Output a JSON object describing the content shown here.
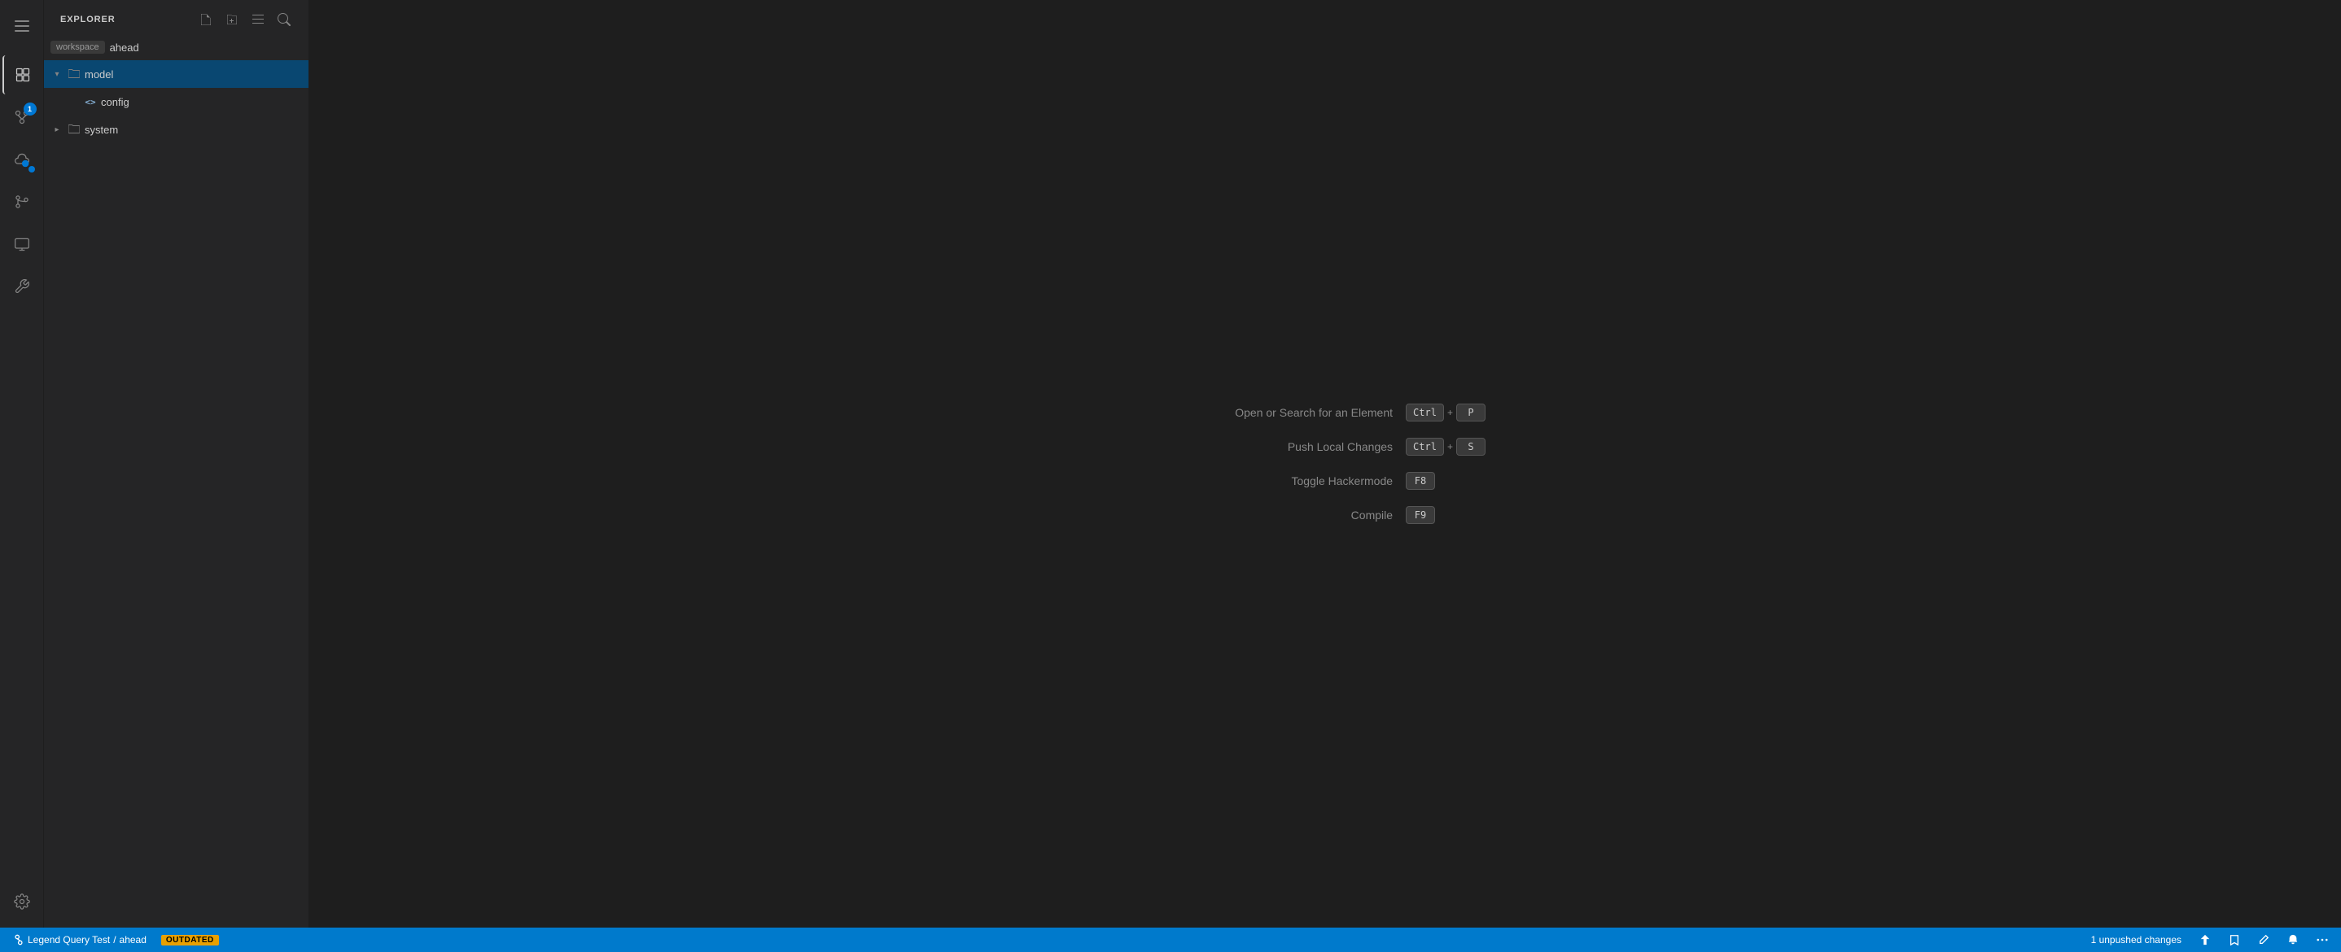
{
  "activityBar": {
    "icons": [
      {
        "name": "hamburger-menu",
        "symbol": "☰",
        "active": false,
        "badge": null
      },
      {
        "name": "explorer",
        "symbol": "⊞",
        "active": true,
        "badge": null
      },
      {
        "name": "source-control",
        "symbol": "⎇",
        "active": false,
        "badge": "1"
      },
      {
        "name": "cloud",
        "symbol": "☁",
        "active": false,
        "badge": null
      },
      {
        "name": "git-branch",
        "symbol": "⑂",
        "active": false,
        "badge": null
      },
      {
        "name": "display",
        "symbol": "▭",
        "active": false,
        "badge": null
      },
      {
        "name": "wrench",
        "symbol": "⚙",
        "active": false,
        "badge": null
      }
    ],
    "bottomIcons": [
      {
        "name": "settings",
        "symbol": "⚙",
        "active": false
      }
    ]
  },
  "sidebar": {
    "title": "EXPLORER",
    "workspaceTag": "workspace",
    "workspaceName": "ahead",
    "actions": [
      {
        "name": "new-file",
        "symbol": "⎘"
      },
      {
        "name": "new-folder",
        "symbol": "+"
      },
      {
        "name": "collapse-all",
        "symbol": "⊟"
      },
      {
        "name": "search",
        "symbol": "⌕"
      }
    ],
    "tree": [
      {
        "label": "model",
        "type": "folder",
        "level": 1,
        "expanded": true,
        "selected": true
      },
      {
        "label": "config",
        "type": "code",
        "level": 2,
        "expanded": false,
        "selected": false
      },
      {
        "label": "system",
        "type": "folder",
        "level": 1,
        "expanded": false,
        "selected": false
      }
    ]
  },
  "shortcuts": [
    {
      "label": "Open or Search for an Element",
      "keys": [
        "Ctrl",
        "+",
        "P"
      ]
    },
    {
      "label": "Push Local Changes",
      "keys": [
        "Ctrl",
        "+",
        "S"
      ]
    },
    {
      "label": "Toggle Hackermode",
      "keys": [
        "F8"
      ]
    },
    {
      "label": "Compile",
      "keys": [
        "F9"
      ]
    }
  ],
  "statusBar": {
    "left": {
      "projectName": "Legend Query Test",
      "separator": "/",
      "branchName": "ahead",
      "outdatedLabel": "OUTDATED"
    },
    "right": {
      "unpushedChanges": "1 unpushed changes"
    }
  }
}
